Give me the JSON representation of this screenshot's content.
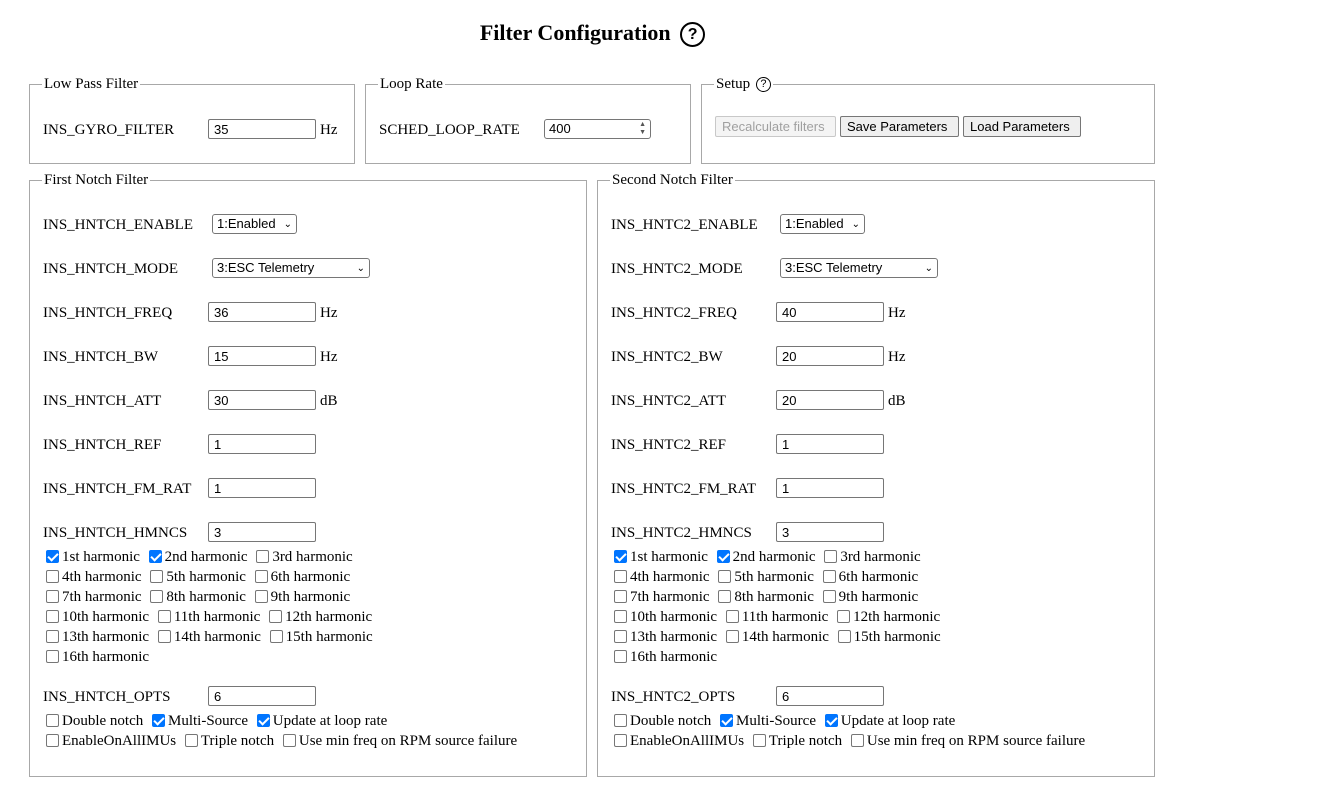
{
  "title": "Filter Configuration",
  "help_glyph": "?",
  "low_pass": {
    "legend": "Low Pass Filter",
    "label": "INS_GYRO_FILTER",
    "value": "35",
    "unit": "Hz"
  },
  "loop_rate": {
    "legend": "Loop Rate",
    "label": "SCHED_LOOP_RATE",
    "value": "400"
  },
  "setup": {
    "legend": "Setup",
    "recalc_label": "Recalculate filters",
    "save_label": "Save Parameters",
    "load_label": "Load Parameters"
  },
  "notch1": {
    "legend": "First Notch Filter",
    "enable_label": "INS_HNTCH_ENABLE",
    "enable_value": "1:Enabled",
    "mode_label": "INS_HNTCH_MODE",
    "mode_value": "3:ESC Telemetry",
    "freq_label": "INS_HNTCH_FREQ",
    "freq_value": "36",
    "freq_unit": "Hz",
    "bw_label": "INS_HNTCH_BW",
    "bw_value": "15",
    "bw_unit": "Hz",
    "att_label": "INS_HNTCH_ATT",
    "att_value": "30",
    "att_unit": "dB",
    "ref_label": "INS_HNTCH_REF",
    "ref_value": "1",
    "fmrat_label": "INS_HNTCH_FM_RAT",
    "fmrat_value": "1",
    "hmncs_label": "INS_HNTCH_HMNCS",
    "hmncs_value": "3",
    "harmonics": [
      {
        "label": "1st harmonic",
        "checked": true
      },
      {
        "label": "2nd harmonic",
        "checked": true
      },
      {
        "label": "3rd harmonic",
        "checked": false
      },
      {
        "label": "4th harmonic",
        "checked": false
      },
      {
        "label": "5th harmonic",
        "checked": false
      },
      {
        "label": "6th harmonic",
        "checked": false
      },
      {
        "label": "7th harmonic",
        "checked": false
      },
      {
        "label": "8th harmonic",
        "checked": false
      },
      {
        "label": "9th harmonic",
        "checked": false
      },
      {
        "label": "10th harmonic",
        "checked": false
      },
      {
        "label": "11th harmonic",
        "checked": false
      },
      {
        "label": "12th harmonic",
        "checked": false
      },
      {
        "label": "13th harmonic",
        "checked": false
      },
      {
        "label": "14th harmonic",
        "checked": false
      },
      {
        "label": "15th harmonic",
        "checked": false
      },
      {
        "label": "16th harmonic",
        "checked": false
      }
    ],
    "opts_label": "INS_HNTCH_OPTS",
    "opts_value": "6",
    "options": [
      {
        "label": "Double notch",
        "checked": false
      },
      {
        "label": "Multi-Source",
        "checked": true
      },
      {
        "label": "Update at loop rate",
        "checked": true
      },
      {
        "label": "EnableOnAllIMUs",
        "checked": false
      },
      {
        "label": "Triple notch",
        "checked": false
      },
      {
        "label": "Use min freq on RPM source failure",
        "checked": false
      }
    ]
  },
  "notch2": {
    "legend": "Second Notch Filter",
    "enable_label": "INS_HNTC2_ENABLE",
    "enable_value": "1:Enabled",
    "mode_label": "INS_HNTC2_MODE",
    "mode_value": "3:ESC Telemetry",
    "freq_label": "INS_HNTC2_FREQ",
    "freq_value": "40",
    "freq_unit": "Hz",
    "bw_label": "INS_HNTC2_BW",
    "bw_value": "20",
    "bw_unit": "Hz",
    "att_label": "INS_HNTC2_ATT",
    "att_value": "20",
    "att_unit": "dB",
    "ref_label": "INS_HNTC2_REF",
    "ref_value": "1",
    "fmrat_label": "INS_HNTC2_FM_RAT",
    "fmrat_value": "1",
    "hmncs_label": "INS_HNTC2_HMNCS",
    "hmncs_value": "3",
    "harmonics": [
      {
        "label": "1st harmonic",
        "checked": true
      },
      {
        "label": "2nd harmonic",
        "checked": true
      },
      {
        "label": "3rd harmonic",
        "checked": false
      },
      {
        "label": "4th harmonic",
        "checked": false
      },
      {
        "label": "5th harmonic",
        "checked": false
      },
      {
        "label": "6th harmonic",
        "checked": false
      },
      {
        "label": "7th harmonic",
        "checked": false
      },
      {
        "label": "8th harmonic",
        "checked": false
      },
      {
        "label": "9th harmonic",
        "checked": false
      },
      {
        "label": "10th harmonic",
        "checked": false
      },
      {
        "label": "11th harmonic",
        "checked": false
      },
      {
        "label": "12th harmonic",
        "checked": false
      },
      {
        "label": "13th harmonic",
        "checked": false
      },
      {
        "label": "14th harmonic",
        "checked": false
      },
      {
        "label": "15th harmonic",
        "checked": false
      },
      {
        "label": "16th harmonic",
        "checked": false
      }
    ],
    "opts_label": "INS_HNTC2_OPTS",
    "opts_value": "6",
    "options": [
      {
        "label": "Double notch",
        "checked": false
      },
      {
        "label": "Multi-Source",
        "checked": true
      },
      {
        "label": "Update at loop rate",
        "checked": true
      },
      {
        "label": "EnableOnAllIMUs",
        "checked": false
      },
      {
        "label": "Triple notch",
        "checked": false
      },
      {
        "label": "Use min freq on RPM source failure",
        "checked": false
      }
    ]
  }
}
